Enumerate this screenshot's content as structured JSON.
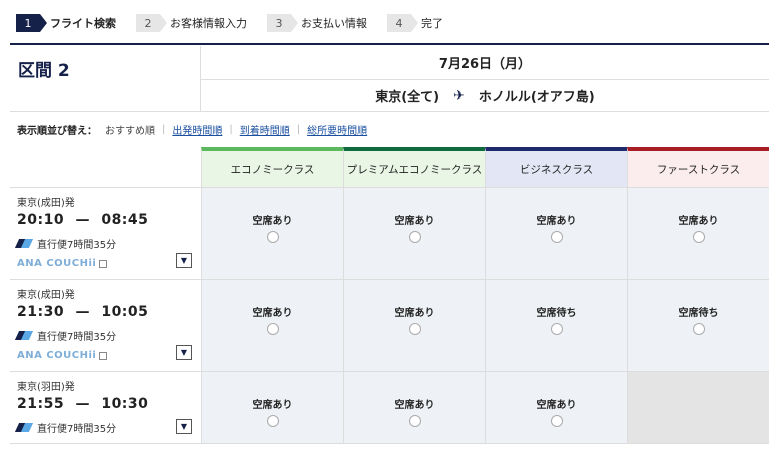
{
  "steps": [
    {
      "num": "1",
      "label": "フライト検索"
    },
    {
      "num": "2",
      "label": "お客様情報入力"
    },
    {
      "num": "3",
      "label": "お支払い情報"
    },
    {
      "num": "4",
      "label": "完了"
    }
  ],
  "section": {
    "title": "区間 2"
  },
  "date": "7月26日（月）",
  "route": {
    "origin": "東京(全て)",
    "plane_icon": "✈",
    "destination": "ホノルル(オアフ島)"
  },
  "sort": {
    "label": "表示順並び替え：",
    "current": "おすすめ順",
    "options": [
      "出発時間順",
      "到着時間順",
      "総所要時間順"
    ]
  },
  "classes": [
    {
      "name": "エコノミークラス",
      "color": "#5cb85c",
      "bg": "#e9f6e6"
    },
    {
      "name": "プレミアムエコノミークラス",
      "color": "#0f6b3e",
      "bg": "#e9f6e6"
    },
    {
      "name": "ビジネスクラス",
      "color": "#1e2a6b",
      "bg": "#e3e7f5"
    },
    {
      "name": "ファーストクラス",
      "color": "#a81e26",
      "bg": "#fbeced"
    }
  ],
  "flights": [
    {
      "from": "東京(成田)発",
      "dep": "20:10",
      "dash": "—",
      "arr": "08:45",
      "duration": "直行便7時間35分",
      "couchii": "ANA COUCHii",
      "seats": [
        "空席あり",
        "空席あり",
        "空席あり",
        "空席あり"
      ]
    },
    {
      "from": "東京(成田)発",
      "dep": "21:30",
      "dash": "—",
      "arr": "10:05",
      "duration": "直行便7時間35分",
      "couchii": "ANA COUCHii",
      "seats": [
        "空席あり",
        "空席あり",
        "空席待ち",
        "空席待ち"
      ]
    },
    {
      "from": "東京(羽田)発",
      "dep": "21:55",
      "dash": "—",
      "arr": "10:30",
      "duration": "直行便7時間35分",
      "couchii": "",
      "seats": [
        "空席あり",
        "空席あり",
        "空席あり",
        ""
      ]
    }
  ],
  "colors": {
    "brand_navy": "#16214a",
    "link": "#1a4fa0",
    "couchii": "#7eaed7"
  }
}
